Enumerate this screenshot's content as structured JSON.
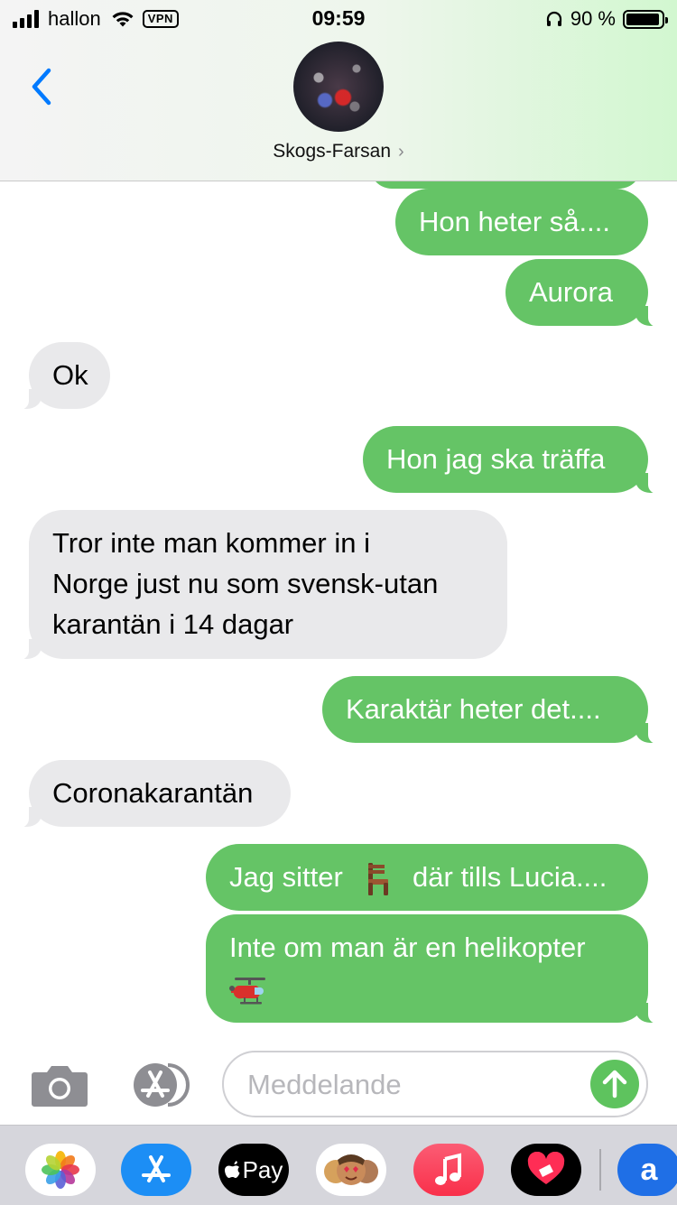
{
  "status_bar": {
    "carrier": "hallon",
    "vpn": "VPN",
    "time": "09:59",
    "battery": "90 %"
  },
  "header": {
    "contact_name": "Skogs-Farsan",
    "chevron": "›"
  },
  "messages": [
    {
      "from": "me",
      "text": "Hon heter så...."
    },
    {
      "from": "me",
      "text": "Aurora"
    },
    {
      "from": "them",
      "text": "Ok"
    },
    {
      "from": "me",
      "text": "Hon jag ska träffa"
    },
    {
      "from": "them",
      "lines": [
        "Tror inte man kommer in i",
        "Norge just nu som svensk-utan",
        "karantän i 14 dagar"
      ]
    },
    {
      "from": "me",
      "text": "Karaktär heter det...."
    },
    {
      "from": "them",
      "text": "Coronakarantän"
    },
    {
      "from": "me",
      "text_before": "Jag sitter",
      "emoji": "chair",
      "text_after": "där tills Lucia...."
    },
    {
      "from": "me",
      "text": "Inte om man är en helikopter",
      "emoji": "helicopter"
    }
  ],
  "input": {
    "placeholder": "Meddelande"
  },
  "app_drawer": {
    "apps": [
      "photos-app",
      "app-store-app",
      "apple-pay-app",
      "memoji-app",
      "music-app",
      "digital-touch-app",
      "amazon-app"
    ],
    "apple_pay_label": "Pay",
    "amazon_label": "a"
  },
  "colors": {
    "outgoing_bubble": "#65c466",
    "incoming_bubble": "#e9e9eb",
    "accent_blue": "#007aff"
  }
}
